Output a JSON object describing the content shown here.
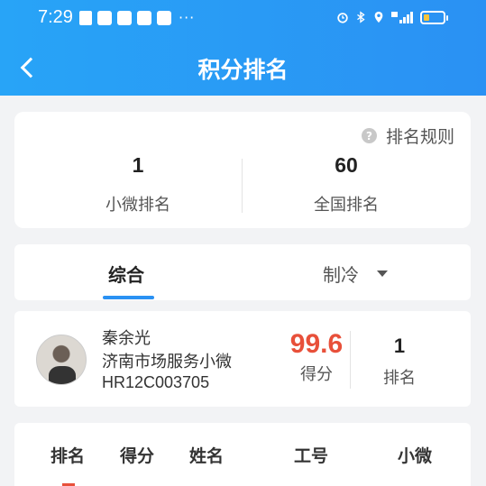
{
  "status_bar": {
    "time": "7:29",
    "more_dots": "···",
    "battery_color": "#f7c43a"
  },
  "header": {
    "title": "积分排名",
    "back_icon": "chevron-left-icon"
  },
  "summary": {
    "rule_label": "排名规则",
    "rule_icon": "question-icon",
    "stats": [
      {
        "value": "1",
        "label": "小微排名"
      },
      {
        "value": "60",
        "label": "全国排名"
      }
    ]
  },
  "tabs": {
    "items": [
      {
        "label": "综合",
        "active": true
      },
      {
        "label": "制冷",
        "active": false,
        "dropdown": true
      }
    ],
    "accent": "#2a91f3"
  },
  "user": {
    "name": "秦余光",
    "org": "济南市场服务小微",
    "id": "HR12C003705",
    "score": "99.6",
    "score_label": "得分",
    "score_color": "#e8503a",
    "rank": "1",
    "rank_label": "排名"
  },
  "table": {
    "headers": [
      "排名",
      "得分",
      "姓名",
      "工号",
      "小微"
    ]
  }
}
